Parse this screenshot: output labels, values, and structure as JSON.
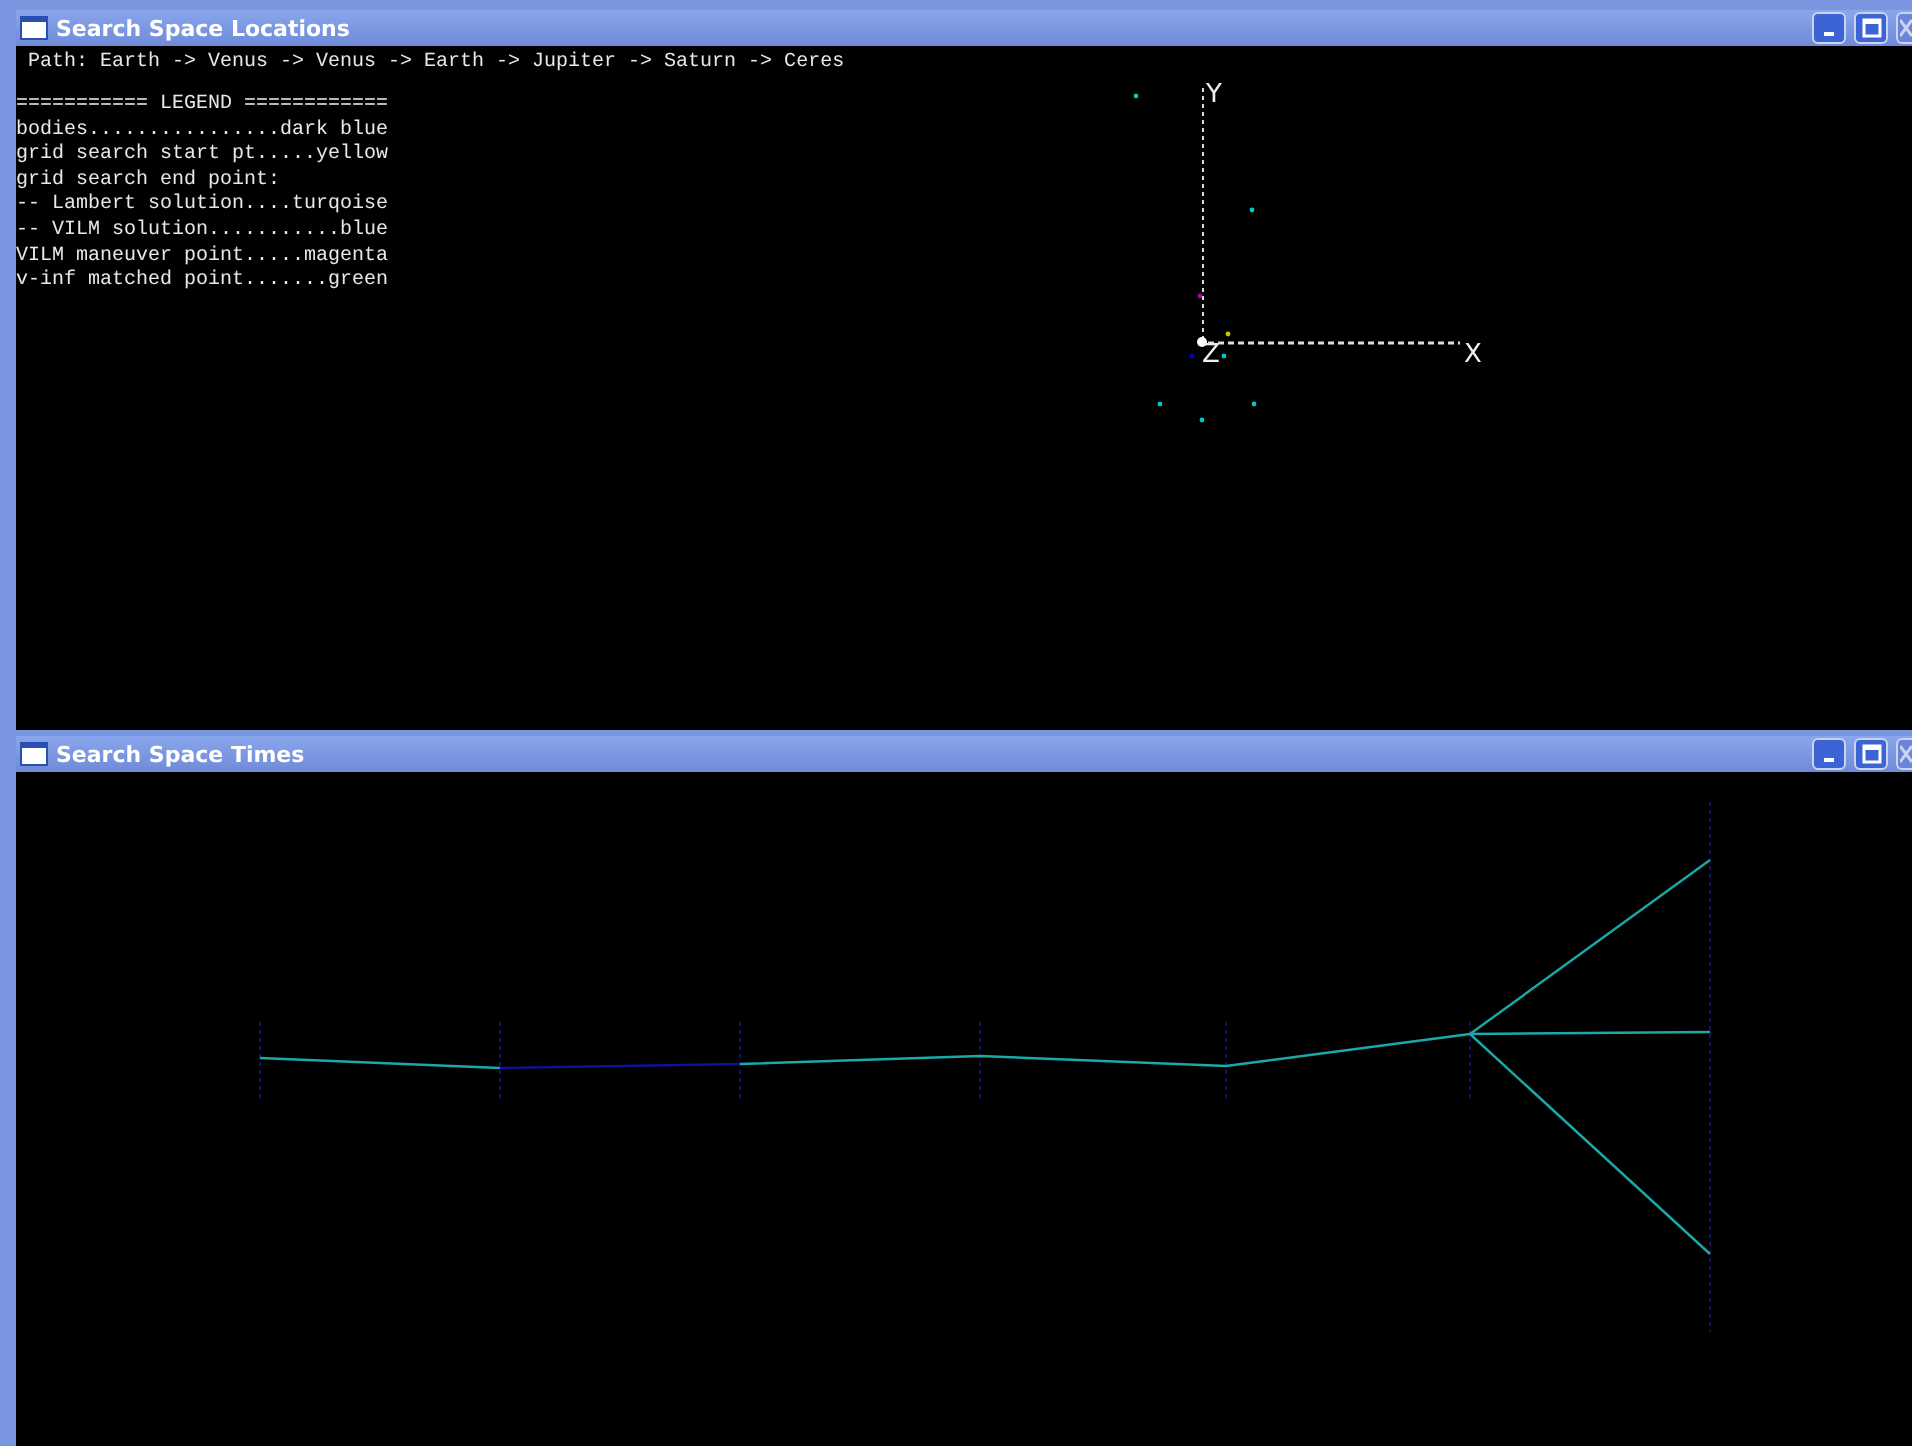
{
  "windows": [
    {
      "title": "Search Space Locations",
      "kind": "locations",
      "path": "Path: Earth -> Venus -> Venus -> Earth -> Jupiter -> Saturn -> Ceres",
      "legend": [
        "=========== LEGEND ============",
        "bodies................dark blue",
        "grid search start pt.....yellow",
        "grid search end point:",
        "-- Lambert solution....turqoise",
        "-- VILM solution...........blue",
        "VILM maneuver point.....magenta",
        "v-inf matched point.......green"
      ],
      "axes": {
        "x": "X",
        "y": "Y",
        "z": "Z"
      }
    },
    {
      "title": "Search Space Times",
      "kind": "times"
    }
  ]
}
